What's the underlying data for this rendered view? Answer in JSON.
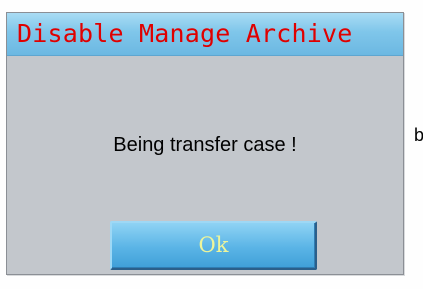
{
  "dialog": {
    "title": "Disable Manage Archive",
    "message": "Being transfer case !",
    "ok_label": "Ok"
  },
  "background": {
    "edge_text": "b"
  },
  "colors": {
    "titlebar_top": "#a9dcf4",
    "titlebar_bottom": "#6cb8e2",
    "title_text": "#e00000",
    "dialog_body": "#c3c7cc",
    "button_face": "#5ab4e6",
    "button_text": "#eef59a",
    "message_text": "#000000"
  }
}
